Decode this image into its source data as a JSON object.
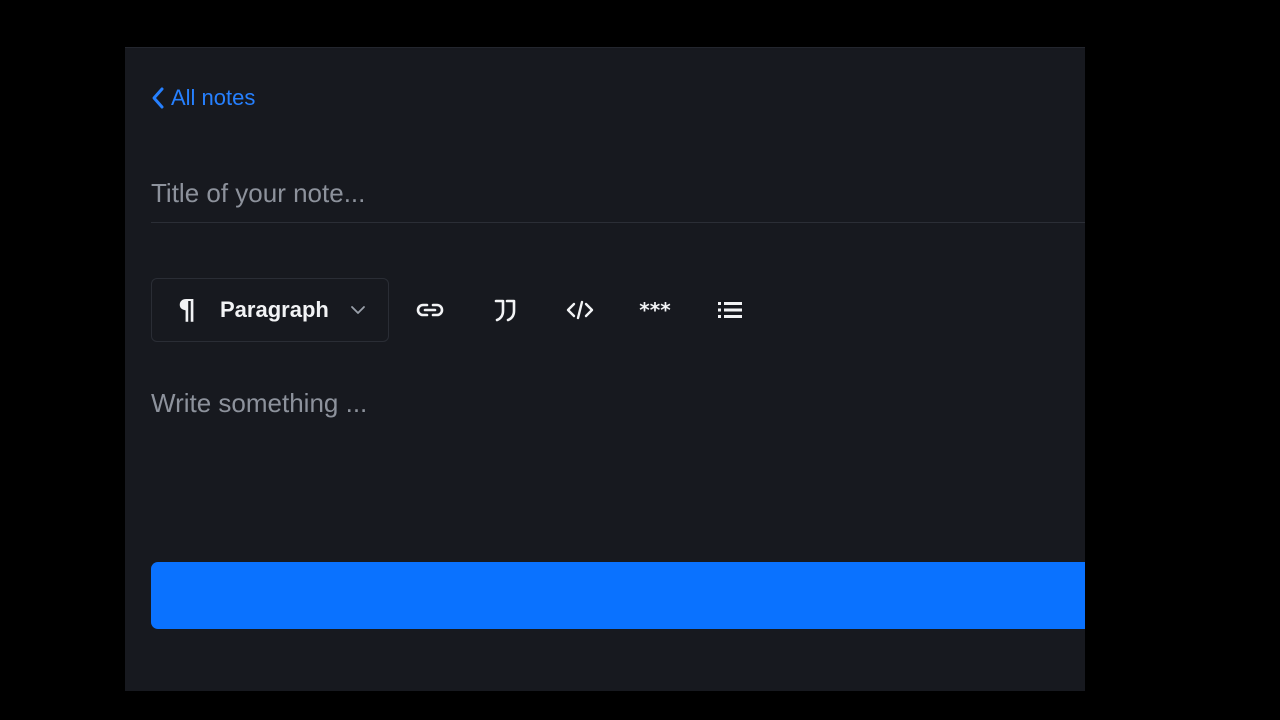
{
  "editor": {
    "back_link": {
      "label": "All notes",
      "icon": "chevron-left-icon"
    },
    "title_field": {
      "value": "",
      "placeholder": "Title of your note..."
    },
    "toolbar": {
      "block_type": {
        "selected": "Paragraph",
        "icon": "pilcrow-icon",
        "dropdown_icon": "chevron-down-icon"
      },
      "link_icon": "link-icon",
      "quote_icon": "quote-icon",
      "code_icon": "code-icon",
      "hr_label": "***",
      "list_icon": "list-icon"
    },
    "body_field": {
      "value": "",
      "placeholder": "Write something ..."
    },
    "submit_button": {
      "label": ""
    }
  },
  "colors": {
    "background": "#000000",
    "panel": "#17191f",
    "accent": "#0a72ff",
    "link": "#2680ff",
    "placeholder": "#8d929c"
  }
}
